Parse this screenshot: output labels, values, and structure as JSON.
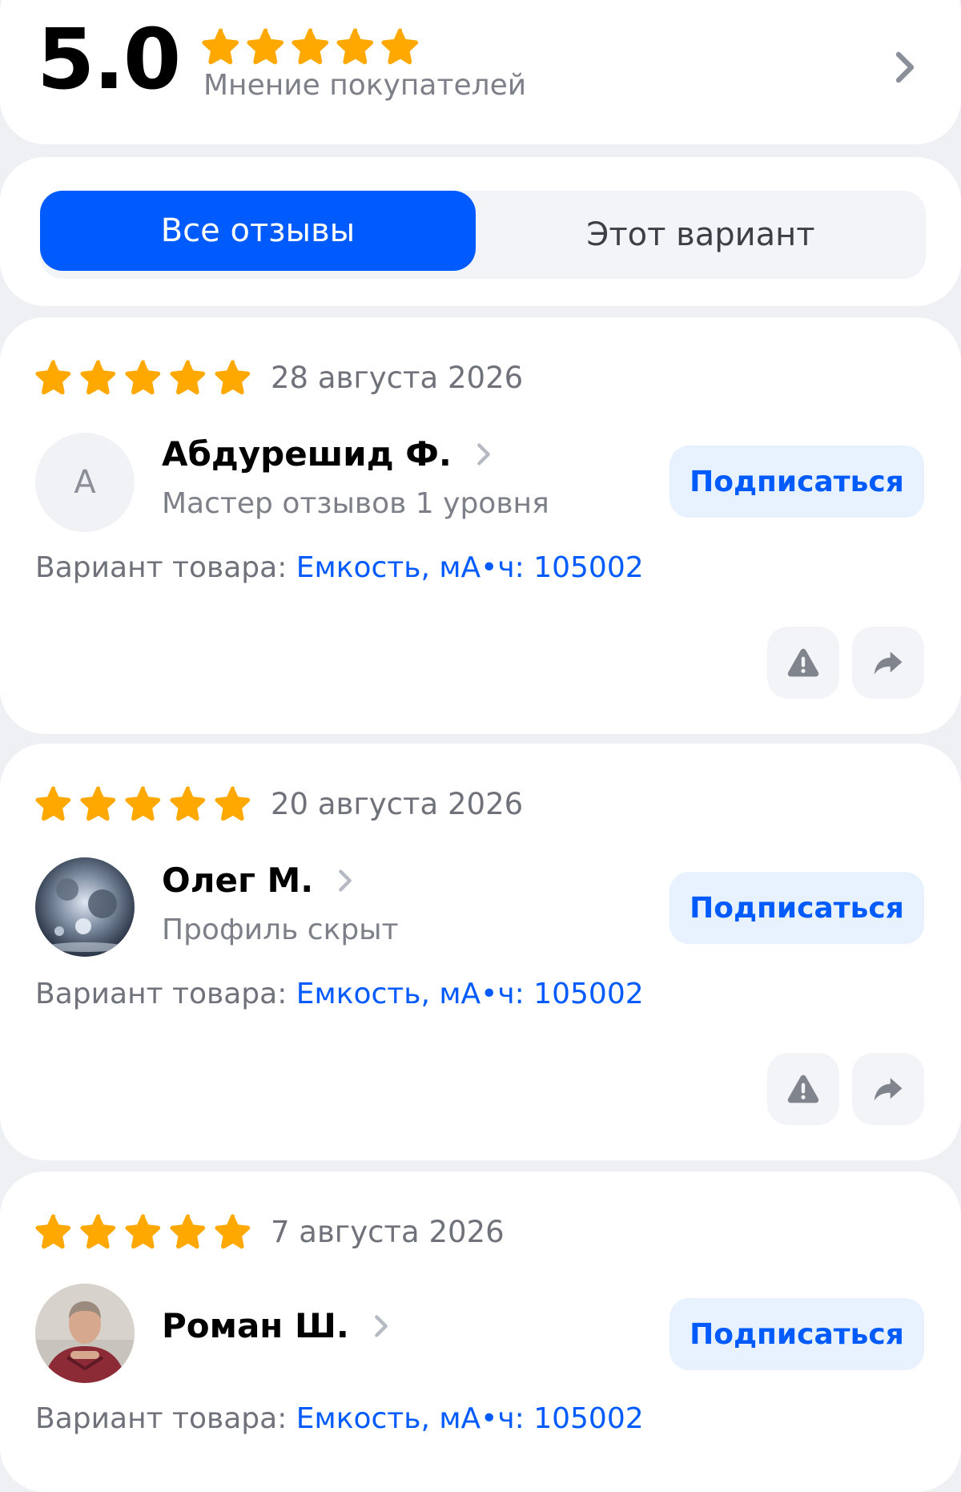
{
  "summary": {
    "rating": "5.0",
    "stars": 5,
    "caption": "Мнение покупателей"
  },
  "tabs": [
    {
      "label": "Все отзывы",
      "active": true
    },
    {
      "label": "Этот вариант",
      "active": false
    }
  ],
  "reviews": [
    {
      "stars": 5,
      "date": "28 августа 2026",
      "avatar_letter": "А",
      "author": "Абдурешид Ф.",
      "author_status": "Мастер отзывов 1 уровня",
      "subscribe_label": "Подписаться",
      "variant_label": "Вариант товара:",
      "variant_value": "Емкость, мА•ч: 105002"
    },
    {
      "stars": 5,
      "date": "20 августа 2026",
      "avatar_letter": "",
      "author": "Олег М.",
      "author_status": "Профиль скрыт",
      "subscribe_label": "Подписаться",
      "variant_label": "Вариант товара:",
      "variant_value": "Емкость, мА•ч: 105002"
    },
    {
      "stars": 5,
      "date": "7 августа 2026",
      "avatar_letter": "",
      "author": "Роман Ш.",
      "author_status": "",
      "subscribe_label": "Подписаться",
      "variant_label": "Вариант товара:",
      "variant_value": "Емкость, мА•ч: 105002"
    }
  ],
  "colors": {
    "accent": "#005bff",
    "star": "#ffa800",
    "background": "#eef0f4",
    "subscribe_bg": "#e8f2ff"
  },
  "icons": {
    "star": "star-icon",
    "chevron": "chevron-right-icon",
    "report": "warning-icon",
    "share": "share-arrow-icon"
  }
}
